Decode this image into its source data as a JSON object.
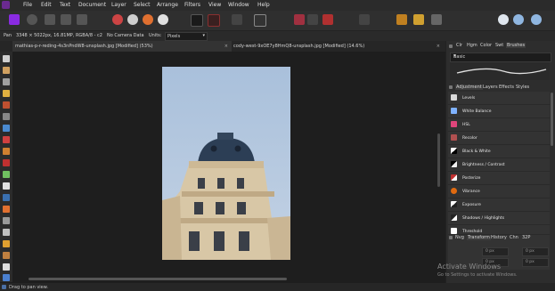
{
  "menu": {
    "items": [
      "File",
      "Edit",
      "Text",
      "Document",
      "Layer",
      "Select",
      "Arrange",
      "Filters",
      "View",
      "Window",
      "Help"
    ]
  },
  "context": {
    "pan_label": "Pan",
    "image_info": "3348 × 5022px, 16.81MP, RGBA/8 - c2",
    "camera": "No Camera Data",
    "units_label": "Units:",
    "units_value": "Pixels"
  },
  "tabs": [
    {
      "label": "mathias-p-r-reding-4s3nPndW8-unsplash.jpg [Modified] (53%)",
      "close": "×"
    },
    {
      "label": "cody-west-9xOE7y8HmQ8-unsplash.jpg [Modified] (14.6%)",
      "close": "×"
    }
  ],
  "panel": {
    "studio_tabs": [
      "Clr",
      "Hgm",
      "Color",
      "Swt",
      "Brushes"
    ],
    "brush_category": "Basic",
    "adjustment_tabs": [
      "Adjustment",
      "Layers",
      "Effects",
      "Styles"
    ],
    "adjustments": [
      {
        "label": "Levels",
        "color": "#d9d9d9"
      },
      {
        "label": "White Balance",
        "color": "#7fb2ff"
      },
      {
        "label": "HSL",
        "color": "#e0457b"
      },
      {
        "label": "Recolor",
        "color": "#b05050"
      },
      {
        "label": "Black & White",
        "color": "#ffffff"
      },
      {
        "label": "Brightness / Contrast",
        "color": "#f0f0f0"
      },
      {
        "label": "Posterize",
        "color": "#c03030"
      },
      {
        "label": "Vibrance",
        "color": "#e06a10"
      },
      {
        "label": "Exposure",
        "color": "#ffffff"
      },
      {
        "label": "Shadows / Highlights",
        "color": "#ffffff"
      },
      {
        "label": "Threshold",
        "color": "#ffffff"
      }
    ],
    "bottom_tabs": [
      "Nvg",
      "Transform",
      "History",
      "Chn",
      "32P"
    ],
    "transform_values": [
      "0 px",
      "0 px",
      "0 px",
      "0 px"
    ]
  },
  "watermark": {
    "title": "Activate Windows",
    "subtitle": "Go to Settings to activate Windows."
  },
  "status": {
    "text": "Drag to pan view."
  }
}
